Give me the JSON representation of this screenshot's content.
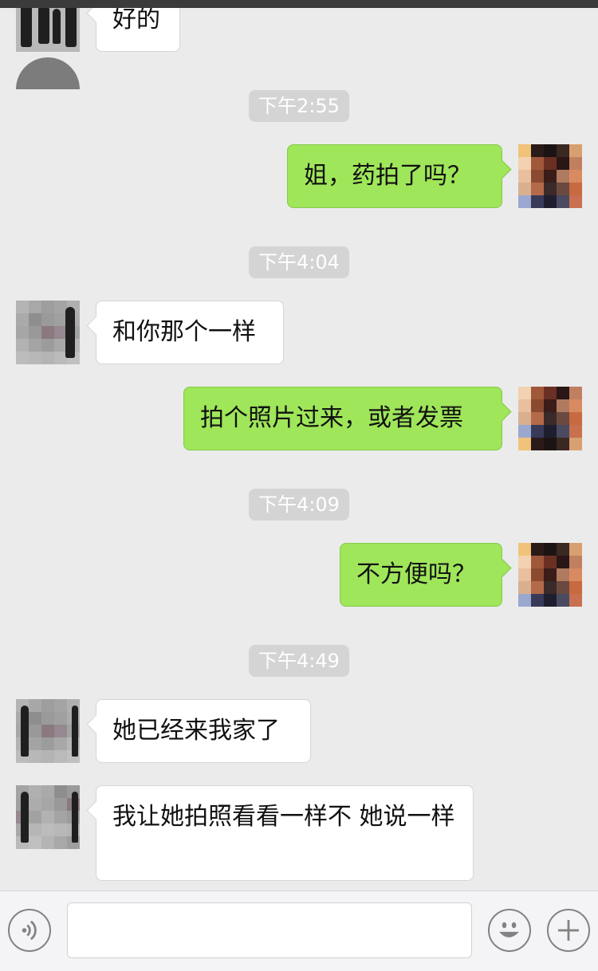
{
  "colors": {
    "background": "#ebebeb",
    "sent_bubble": "#9fe65a",
    "received_bubble": "#ffffff",
    "timestamp_bg": "#d4d4d4"
  },
  "messages": [
    {
      "side": "left",
      "text": "好的",
      "avatar": "contact-avatar"
    },
    {
      "side": "time",
      "text": "下午2:55"
    },
    {
      "side": "right",
      "text": "姐，药拍了吗？",
      "avatar": "self-avatar"
    },
    {
      "side": "time",
      "text": "下午4:04"
    },
    {
      "side": "left",
      "text": "和你那个一样",
      "avatar": "contact-avatar"
    },
    {
      "side": "right",
      "text": "拍个照片过来，或者发票",
      "avatar": "self-avatar"
    },
    {
      "side": "time",
      "text": "下午4:09"
    },
    {
      "side": "right",
      "text": "不方便吗？",
      "avatar": "self-avatar"
    },
    {
      "side": "time",
      "text": "下午4:49"
    },
    {
      "side": "left",
      "text": "她已经来我家了",
      "avatar": "contact-avatar"
    },
    {
      "side": "left",
      "text": "我让她拍照看看一样不 她说一样",
      "avatar": "contact-avatar"
    }
  ],
  "input_bar": {
    "text_value": "",
    "icons": [
      "voice-icon",
      "emoji-icon",
      "plus-icon"
    ]
  }
}
